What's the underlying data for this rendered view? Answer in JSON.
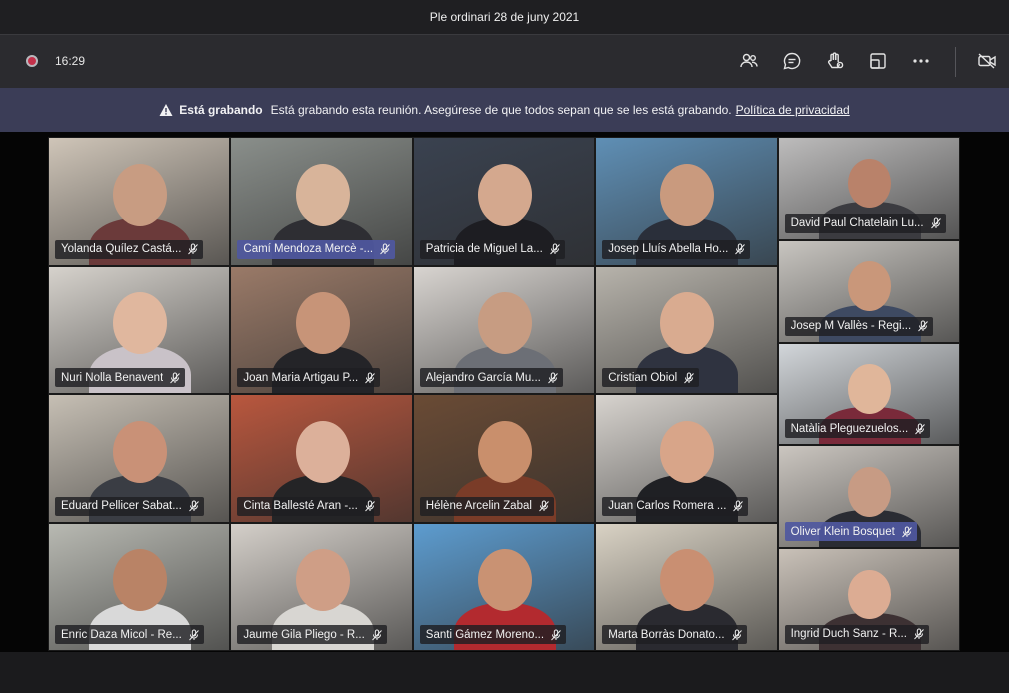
{
  "window": {
    "title": "Ple ordinari 28 de juny 2021"
  },
  "toolbar": {
    "timer": "16:29",
    "icons": [
      "recording-indicator",
      "participants-icon",
      "chat-icon",
      "reactions-icon",
      "breakout-rooms-icon",
      "more-options-icon",
      "camera-off-icon"
    ]
  },
  "banner": {
    "title": "Está grabando",
    "message": "Está grabando esta reunión. Asegúrese de que todos sepan que se les está grabando.",
    "link": "Política de privacidad"
  },
  "participants": [
    {
      "name": "Yolanda Quílez Castá...",
      "active": false,
      "bg": "#cfc5b8",
      "skin": "#c89c82",
      "shirt": "#6b3a3a"
    },
    {
      "name": "Camí Mendoza Mercè -...",
      "active": true,
      "bg": "#8a8f8b",
      "skin": "#d8b49a",
      "shirt": "#2e2e33"
    },
    {
      "name": "Patricia de Miguel La...",
      "active": false,
      "bg": "#3a4250",
      "skin": "#d4a88e",
      "shirt": "#1d1d22"
    },
    {
      "name": "Josep Lluís Abella Ho...",
      "active": false,
      "bg": "#5f8fb5",
      "skin": "#c99a7e",
      "shirt": "#2a2f3a"
    },
    {
      "name": "David Paul Chatelain Lu...",
      "active": false,
      "bg": "#bdbcbc",
      "skin": "#b9826a",
      "shirt": "#3b3b40"
    },
    {
      "name": "Nuri Nolla Benavent",
      "active": false,
      "bg": "#d6d2cc",
      "skin": "#e0b79e",
      "shirt": "#c9c2c8"
    },
    {
      "name": "Joan Maria Artigau P...",
      "active": false,
      "bg": "#9a7a68",
      "skin": "#c79478",
      "shirt": "#242428"
    },
    {
      "name": "Alejandro García Mu...",
      "active": false,
      "bg": "#d8d4d0",
      "skin": "#c79c82",
      "shirt": "#6c6f76"
    },
    {
      "name": "Cristian Obiol",
      "active": false,
      "bg": "#b7b3ab",
      "skin": "#d9ab90",
      "shirt": "#2f3340"
    },
    {
      "name": "Josep M Vallès - Regi...",
      "active": false,
      "bg": "#c8c5c0",
      "skin": "#c9977a",
      "shirt": "#3e4a62"
    },
    {
      "name": "Natàlia Pleguezuelos...",
      "active": false,
      "bg": "#d2d6da",
      "skin": "#e0b69a",
      "shirt": "#7a2a3a"
    },
    {
      "name": "Eduard Pellicer Sabat...",
      "active": false,
      "bg": "#c6bfb4",
      "skin": "#c99177",
      "shirt": "#3a3d44"
    },
    {
      "name": "Cinta Ballesté Aran -...",
      "active": false,
      "bg": "#b9573e",
      "skin": "#dcb09a",
      "shirt": "#242426"
    },
    {
      "name": "Hélène Arcelin Zabal",
      "active": false,
      "bg": "#6a4b35",
      "skin": "#c98f6c",
      "shirt": "#7a3c28"
    },
    {
      "name": "Juan Carlos Romera ...",
      "active": false,
      "bg": "#d7d3ce",
      "skin": "#d8a589",
      "shirt": "#1f2024"
    },
    {
      "name": "Oliver Klein Bosquet",
      "active": true,
      "bg": "#cbc6c0",
      "skin": "#c79b84",
      "shirt": "#2a2c33"
    },
    {
      "name": "Enric Daza Micol - Re...",
      "active": false,
      "bg": "#b8b9b2",
      "skin": "#b98366",
      "shirt": "#d9d9d9"
    },
    {
      "name": "Jaume Gila Pliego - R...",
      "active": false,
      "bg": "#d4cfc9",
      "skin": "#cf9e86",
      "shirt": "#d8d6d2"
    },
    {
      "name": "Santi Gámez Moreno...",
      "active": false,
      "bg": "#5d9ccf",
      "skin": "#c99273",
      "shirt": "#b32a2f"
    },
    {
      "name": "Marta Borràs Donato...",
      "active": false,
      "bg": "#d9d2c4",
      "skin": "#c98f72",
      "shirt": "#2a2a30"
    },
    {
      "name": "Ingrid Duch Sanz - R...",
      "active": false,
      "bg": "#c9c1b8",
      "skin": "#dcac93",
      "shirt": "#3d3133"
    }
  ]
}
